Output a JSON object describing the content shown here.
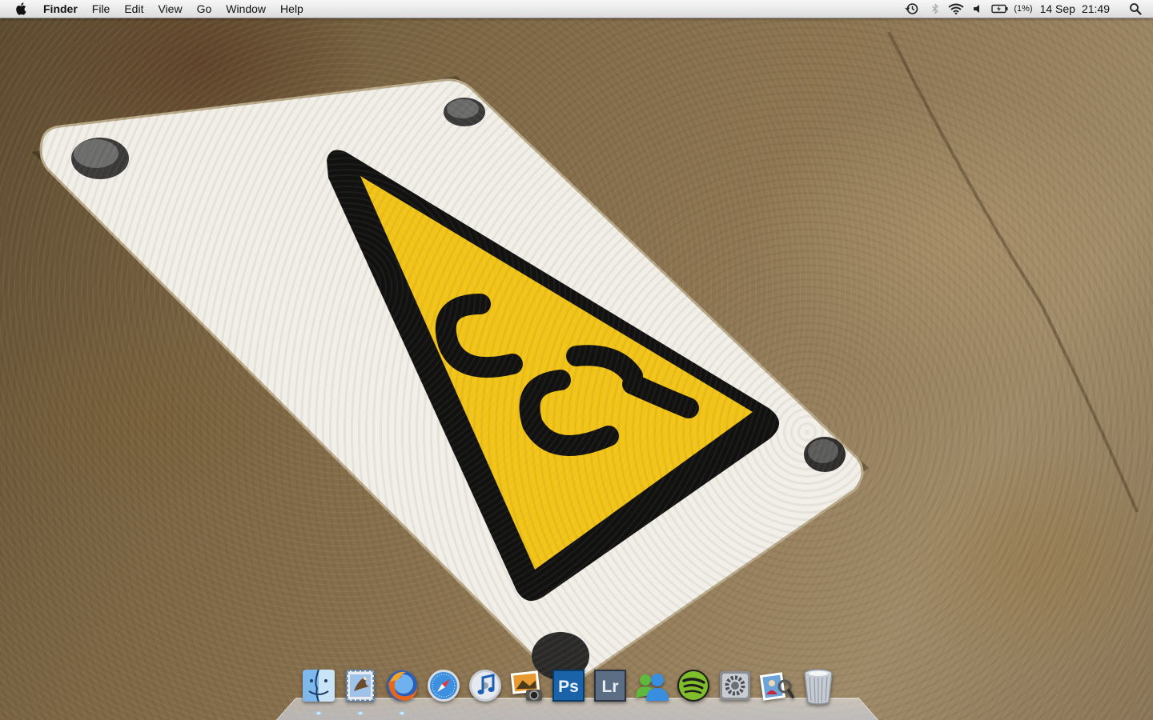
{
  "menubar": {
    "apple_icon": "apple-icon",
    "app_name": "Finder",
    "menus": [
      "File",
      "Edit",
      "View",
      "Go",
      "Window",
      "Help"
    ],
    "status_icons": [
      "time-machine-icon",
      "bluetooth-icon",
      "wifi-icon",
      "volume-icon",
      "battery-icon"
    ],
    "battery_text": "(1%)",
    "date": "14 Sep",
    "time": "21:49",
    "spotlight_icon": "spotlight-icon"
  },
  "dock": {
    "items": [
      {
        "icon": "finder-icon",
        "running": true
      },
      {
        "icon": "mail-icon",
        "running": true
      },
      {
        "icon": "firefox-icon",
        "running": true
      },
      {
        "icon": "safari-icon",
        "running": false
      },
      {
        "icon": "itunes-icon",
        "running": false
      },
      {
        "icon": "iphoto-icon",
        "running": false
      },
      {
        "icon": "photoshop-icon",
        "label": "Ps",
        "running": false
      },
      {
        "icon": "lightroom-icon",
        "label": "Lr",
        "running": false
      },
      {
        "icon": "messenger-icon",
        "running": false
      },
      {
        "icon": "spotify-icon",
        "running": false
      },
      {
        "icon": "system-preferences-icon",
        "running": false
      },
      {
        "icon": "preview-icon",
        "running": false
      },
      {
        "icon": "trash-icon",
        "running": false
      }
    ]
  },
  "colors": {
    "sign_yellow": "#f2c418",
    "sign_white": "#f1efe8",
    "sign_black": "#111111",
    "dock_running": "#9fd4ff"
  }
}
